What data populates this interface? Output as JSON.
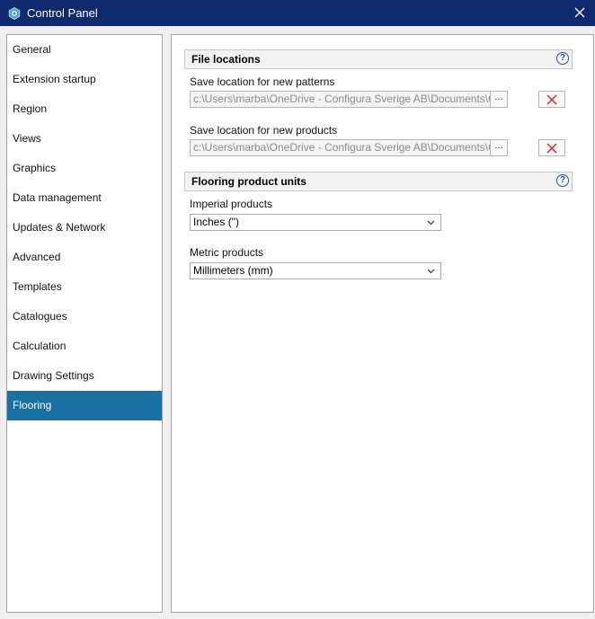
{
  "window": {
    "title": "Control Panel"
  },
  "sidebar": {
    "items": [
      {
        "label": "General"
      },
      {
        "label": "Extension startup"
      },
      {
        "label": "Region"
      },
      {
        "label": "Views"
      },
      {
        "label": "Graphics"
      },
      {
        "label": "Data management"
      },
      {
        "label": "Updates & Network"
      },
      {
        "label": "Advanced"
      },
      {
        "label": "Templates"
      },
      {
        "label": "Catalogues"
      },
      {
        "label": "Calculation"
      },
      {
        "label": "Drawing Settings"
      },
      {
        "label": "Flooring",
        "selected": true
      }
    ]
  },
  "file_locations": {
    "header": "File locations",
    "patterns_label": "Save location for new patterns",
    "patterns_value": "c:\\Users\\marba\\OneDrive - Configura Sverige AB\\Documents\\CET",
    "products_label": "Save location for new products",
    "products_value": "c:\\Users\\marba\\OneDrive - Configura Sverige AB\\Documents\\CET",
    "browse_label": "...",
    "help": "?"
  },
  "units": {
    "header": "Flooring product units",
    "imperial_label": "Imperial products",
    "imperial_value": "Inches (\")",
    "metric_label": "Metric products",
    "metric_value": "Millimeters (mm)",
    "help": "?"
  },
  "colors": {
    "title_bar": "#0f2a6e",
    "selected": "#1a6fa3",
    "clear_x": "#d0282d"
  }
}
